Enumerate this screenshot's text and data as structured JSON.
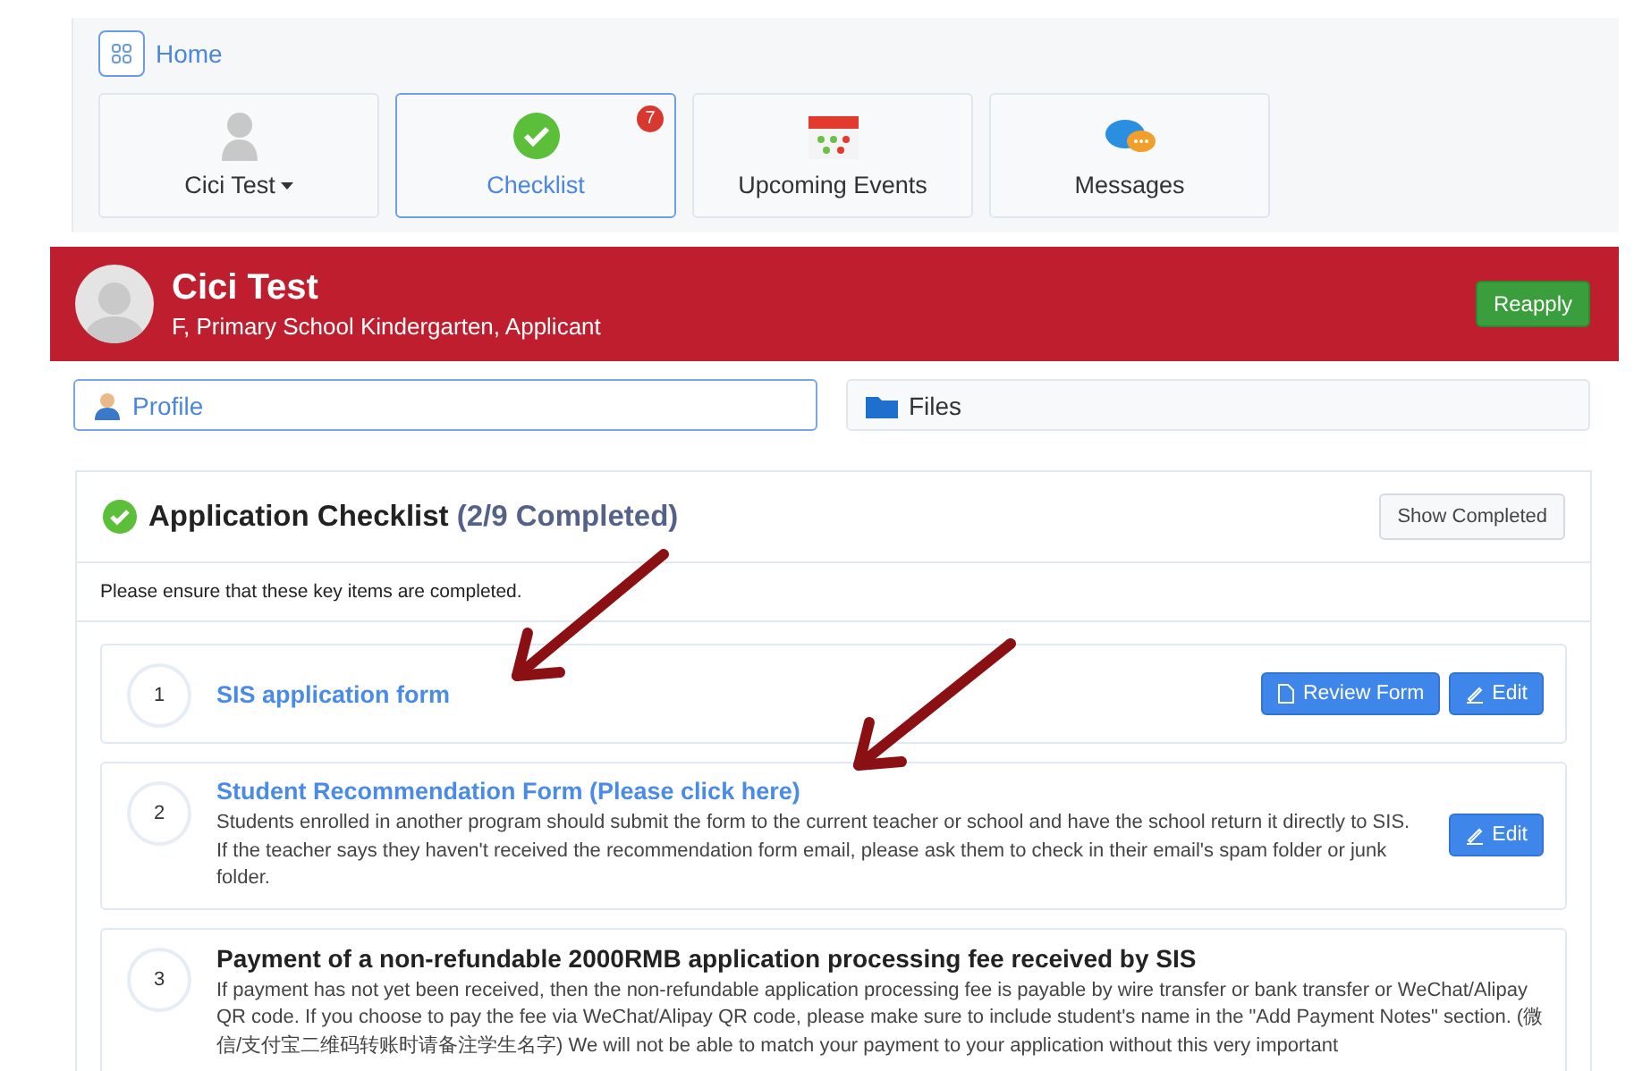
{
  "breadcrumb": {
    "label": "Home"
  },
  "tiles": [
    {
      "kind": "person",
      "label": "Cici Test",
      "selected": false,
      "dropdown": true
    },
    {
      "kind": "check",
      "label": "Checklist",
      "selected": true,
      "badge": "7"
    },
    {
      "kind": "calendar",
      "label": "Upcoming Events",
      "selected": false
    },
    {
      "kind": "chat",
      "label": "Messages",
      "selected": false
    }
  ],
  "banner": {
    "name": "Cici Test",
    "details": "F, Primary School Kindergarten, Applicant",
    "button": "Reapply"
  },
  "tabs": [
    {
      "kind": "profile",
      "label": "Profile",
      "selected": true
    },
    {
      "kind": "files",
      "label": "Files",
      "selected": false
    }
  ],
  "checklist": {
    "title": "Application Checklist",
    "progress": "(2/9 Completed)",
    "button": "Show Completed",
    "note": "Please ensure that these key items are completed.",
    "items": [
      {
        "number": "1",
        "kind": "link",
        "title": "SIS application form",
        "buttons": [
          {
            "kind": "review",
            "label": "Review Form"
          },
          {
            "kind": "edit",
            "label": "Edit"
          }
        ]
      },
      {
        "number": "2",
        "kind": "link",
        "title": "Student Recommendation Form (Please click here)",
        "description": "Students enrolled in another program should submit the form to the current teacher or school and have the school return it directly to SIS. If the teacher says they haven't received the recommendation form email, please ask them to check in their email's spam folder or junk folder.",
        "buttons": [
          {
            "kind": "edit",
            "label": "Edit"
          }
        ]
      },
      {
        "number": "3",
        "kind": "heading",
        "title": "Payment of a non-refundable 2000RMB application processing fee received by SIS",
        "description": "If payment has not yet been received, then the non-refundable application processing fee is payable by wire transfer or bank transfer or WeChat/Alipay QR code. If you choose to pay the fee via WeChat/Alipay QR code, please make sure to include student's name in the \"Add Payment Notes\" section. (微信/支付宝二维码转账时请备注学生名字) We will not be able to match your payment to your application without this very important"
      }
    ]
  }
}
